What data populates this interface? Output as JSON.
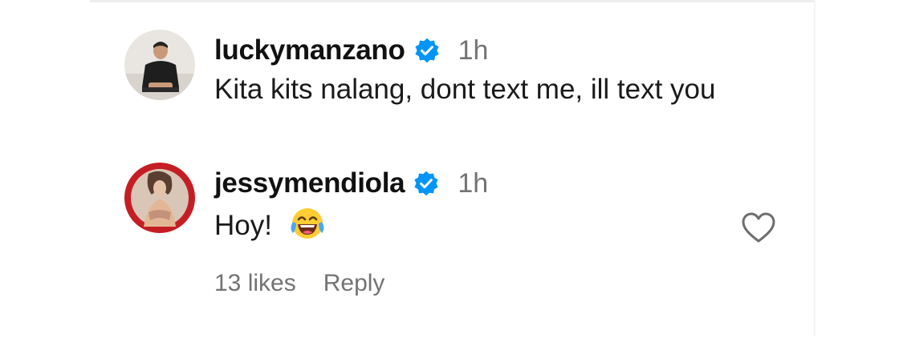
{
  "comments": [
    {
      "username": "luckymanzano",
      "verified": true,
      "time": "1h",
      "text": "Kita kits nalang, dont text me, ill text you",
      "avatar_icon": "avatar-photo"
    },
    {
      "username": "jessymendiola",
      "verified": true,
      "time": "1h",
      "text": "Hoy!",
      "emoji": "face-with-tears-of-joy",
      "likes_label": "13 likes",
      "reply_label": "Reply",
      "like_icon": "heart-outline-icon",
      "avatar_icon": "avatar-photo"
    }
  ],
  "colors": {
    "text": "#111111",
    "muted": "#737373",
    "verified_badge": "#0095f6",
    "avatar2_bg": "#c41e24"
  }
}
